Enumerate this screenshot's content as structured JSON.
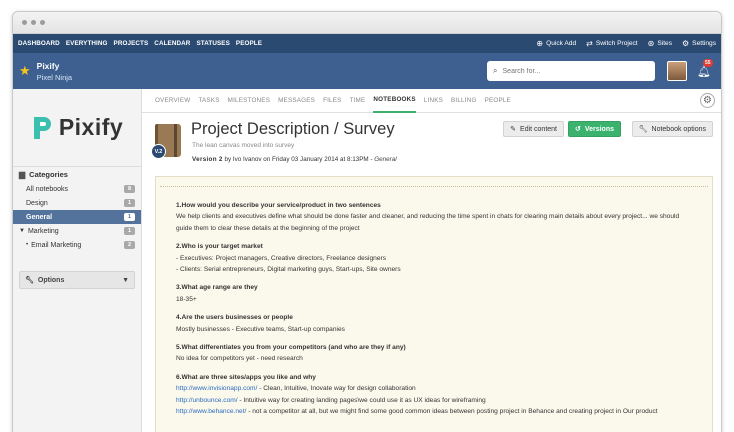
{
  "topnav": {
    "items": [
      "DASHBOARD",
      "EVERYTHING",
      "PROJECTS",
      "CALENDAR",
      "STATUSES",
      "PEOPLE"
    ],
    "right": [
      {
        "label": "Quick Add",
        "icon": "plus-circle-icon"
      },
      {
        "label": "Switch Project",
        "icon": "switch-icon"
      },
      {
        "label": "Sites",
        "icon": "globe-icon"
      },
      {
        "label": "Settings",
        "icon": "gear-icon"
      }
    ]
  },
  "project": {
    "title": "Pixify",
    "subtitle": "Pixel Ninja",
    "search_placeholder": "Search for...",
    "notification_count": "55"
  },
  "sidebar": {
    "logo_text": "Pixify",
    "categories_title": "Categories",
    "items": [
      {
        "label": "All notebooks",
        "count": "8"
      },
      {
        "label": "Design",
        "count": "1"
      },
      {
        "label": "General",
        "count": "1"
      },
      {
        "label": "Marketing",
        "count": "1"
      },
      {
        "label": "Email Marketing",
        "count": "2"
      }
    ],
    "options_label": "Options"
  },
  "tabs": [
    "OVERVIEW",
    "TASKS",
    "MILESTONES",
    "MESSAGES",
    "FILES",
    "TIME",
    "NOTEBOOKS",
    "LINKS",
    "BILLING",
    "PEOPLE"
  ],
  "doc": {
    "version_badge": "V.2",
    "title": "Project Description / Survey",
    "subtitle": "The lean canvas moved into survey",
    "meta_version": "Version 2",
    "meta_by": " by Ivo Ivanov on Friday 03 January 2014 at 8:13PM - ",
    "meta_category": "General",
    "edit_label": "Edit content",
    "versions_label": "Versions",
    "notebook_options_label": "Notebook options"
  },
  "content": {
    "q1": "1.How would you describe your service/product in two sentences",
    "a1": "We help clients and executives define what should be done faster and cleaner, and reducing the time spent in chats for clearing main details about every project... we should guide them to clear these details at the beginning of the project",
    "q2": "2.Who is your target market",
    "a2a": "- Executives: Project managers, Creative directors, Freelance designers",
    "a2b": "- Clients: Serial entrepreneurs, Digital marketing guys, Start-ups, Site owners",
    "q3": "3.What age range are they",
    "a3": "18-35+",
    "q4": "4.Are the users businesses or people",
    "a4": "Mostly businesses - Executive teams, Start-up companies",
    "q5": "5.What differentiates you from your competitors (and who are they if any)",
    "a5": "No idea for competitors yet - need research",
    "q6": "6.What are three sites/apps you like and why",
    "l1": "http://www.invisionapp.com/",
    "t1": " - Clean, Intuitive, Inovate way for design collaboration",
    "l2": "http://unbounce.com/",
    "t2": " - Intuitive way for creating landing pages\\we could use it as UX ideas for wireframing",
    "l3": "http://www.behance.net/",
    "t3": " - not a competitor at all, but we might find some good common ideas between posting project in Behance and creating project in Our product"
  },
  "colors": {
    "nav_bg": "#2b4a72",
    "project_bar_bg": "#3d6091",
    "accent_green": "#3bb36e",
    "active_category_bg": "#53729c",
    "link": "#2a6bbf"
  }
}
